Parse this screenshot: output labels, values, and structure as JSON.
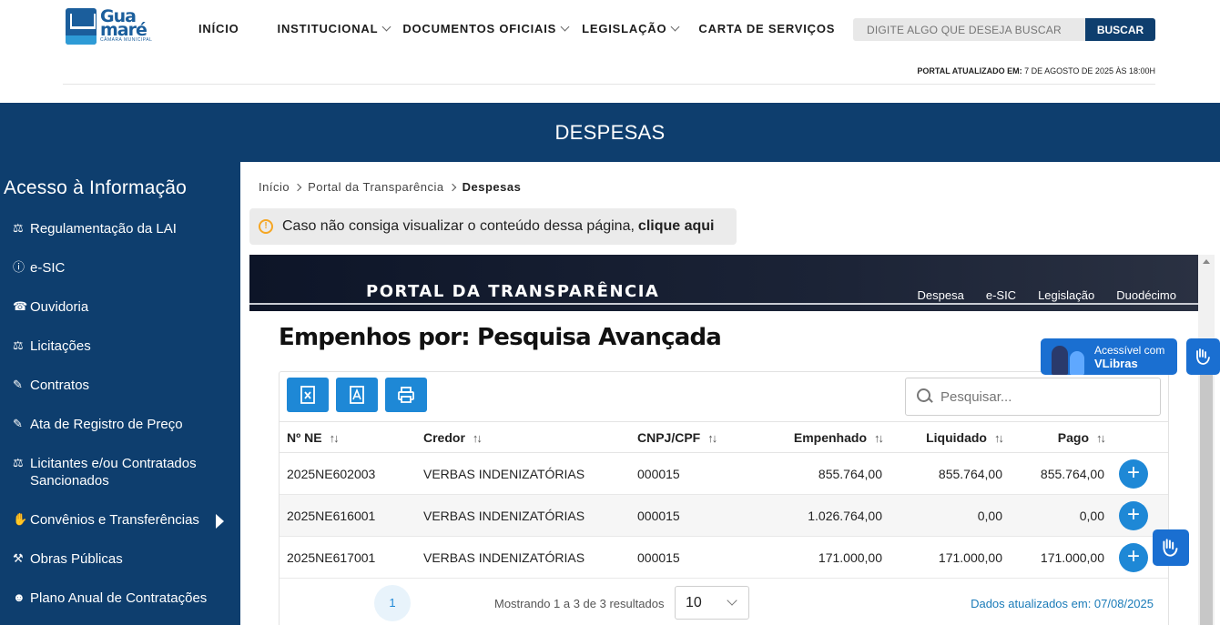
{
  "header": {
    "logo": {
      "line1": "Gua",
      "line2": "maré",
      "line3": "CÂMARA MUNICIPAL"
    },
    "nav": [
      {
        "label": "INÍCIO"
      },
      {
        "label": "INSTITUCIONAL"
      },
      {
        "label": "DOCUMENTOS OFICIAIS"
      },
      {
        "label": "LEGISLAÇÃO"
      },
      {
        "label": "CARTA DE SERVIÇOS"
      }
    ],
    "search_placeholder": "DIGITE ALGO QUE DESEJA BUSCAR",
    "search_button": "BUSCAR",
    "updated_label": "PORTAL ATUALIZADO EM:",
    "updated_value": "7 DE AGOSTO DE 2025 ÀS 18:00H"
  },
  "band_title": "DESPESAS",
  "sidebar": {
    "title": "Acesso à Informação",
    "items": [
      {
        "label": "Regulamentação da LAI",
        "icon": "gavel-icon"
      },
      {
        "label": "e-SIC",
        "icon": "info-icon"
      },
      {
        "label": "Ouvidoria",
        "icon": "megaphone-icon"
      },
      {
        "label": "Licitações",
        "icon": "gavel-icon"
      },
      {
        "label": "Contratos",
        "icon": "document-edit-icon"
      },
      {
        "label": "Ata de Registro de Preço",
        "icon": "document-edit-icon"
      },
      {
        "label": "Licitantes e/ou Contratados Sancionados",
        "icon": "gavel-icon"
      },
      {
        "label": "Convênios e Transferências",
        "icon": "handshake-icon"
      },
      {
        "label": "Obras Públicas",
        "icon": "worker-icon"
      },
      {
        "label": "Plano Anual de Contratações",
        "icon": "people-icon"
      }
    ]
  },
  "breadcrumb": [
    "Início",
    "Portal da Transparência",
    "Despesas"
  ],
  "alert": {
    "text": "Caso não consiga visualizar o conteúdo dessa página,",
    "link": "clique aqui"
  },
  "portal": {
    "title": "PORTAL DA TRANSPARÊNCIA",
    "nav": [
      "Despesa",
      "e-SIC",
      "Legislação",
      "Duodécimo"
    ],
    "heading": "Empenhos por: Pesquisa Avançada",
    "search_placeholder": "Pesquisar...",
    "columns": [
      "Nº NE",
      "Credor",
      "CNPJ/CPF",
      "Empenhado",
      "Liquidado",
      "Pago"
    ],
    "rows": [
      {
        "ne": "2025NE602003",
        "credor": "VERBAS INDENIZATÓRIAS",
        "cnpj": "000015",
        "empenhado": "855.764,00",
        "liquidado": "855.764,00",
        "pago": "855.764,00"
      },
      {
        "ne": "2025NE616001",
        "credor": "VERBAS INDENIZATÓRIAS",
        "cnpj": "000015",
        "empenhado": "1.026.764,00",
        "liquidado": "0,00",
        "pago": "0,00"
      },
      {
        "ne": "2025NE617001",
        "credor": "VERBAS INDENIZATÓRIAS",
        "cnpj": "000015",
        "empenhado": "171.000,00",
        "liquidado": "171.000,00",
        "pago": "171.000,00"
      }
    ],
    "page": "1",
    "showing": "Mostrando 1 a 3 de 3 resultados",
    "per_page": "10",
    "data_updated": "Dados atualizados em: 07/08/2025"
  },
  "vlibras": {
    "line1": "Acessível com",
    "line2": "VLibras"
  },
  "colors": {
    "primary": "#0e3e6e",
    "accent": "#1e88d6",
    "warning": "#f5a623"
  }
}
